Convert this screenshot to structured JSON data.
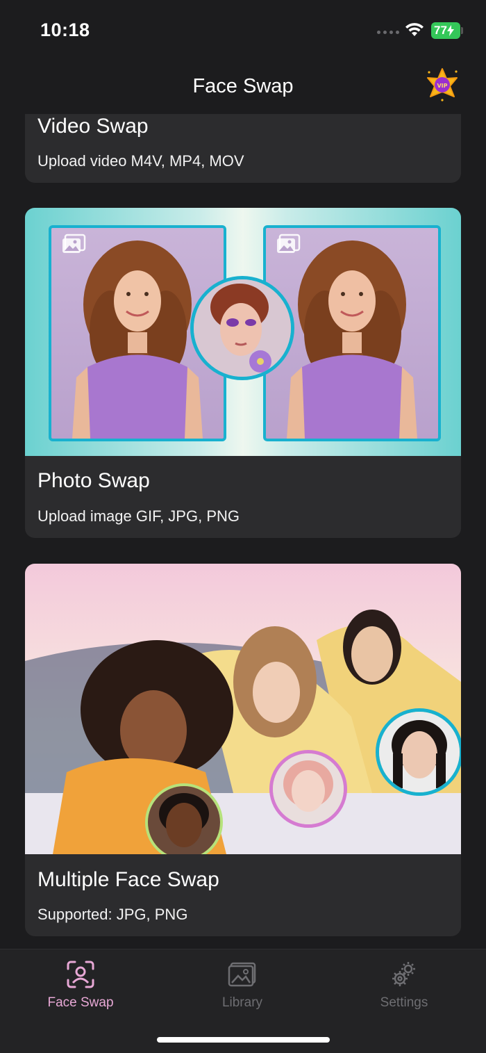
{
  "status_bar": {
    "time": "10:18",
    "battery": "77"
  },
  "header": {
    "title": "Face Swap",
    "vip_label": "VIP"
  },
  "cards": {
    "video": {
      "title": "Video Swap",
      "subtitle": "Upload video M4V, MP4, MOV"
    },
    "photo": {
      "title": "Photo Swap",
      "subtitle": "Upload image GIF, JPG, PNG"
    },
    "multi": {
      "title": "Multiple Face Swap",
      "subtitle": "Supported: JPG, PNG"
    }
  },
  "tab_bar": {
    "items": [
      {
        "label": "Face Swap",
        "icon": "face-scan-icon",
        "active": true
      },
      {
        "label": "Library",
        "icon": "gallery-icon",
        "active": false
      },
      {
        "label": "Settings",
        "icon": "gear-icon",
        "active": false
      }
    ]
  },
  "colors": {
    "background": "#1c1c1e",
    "card": "#2c2c2e",
    "accent_active_tab": "#e8a8d6",
    "frame_border": "#18b1cf",
    "battery": "#34c759"
  }
}
